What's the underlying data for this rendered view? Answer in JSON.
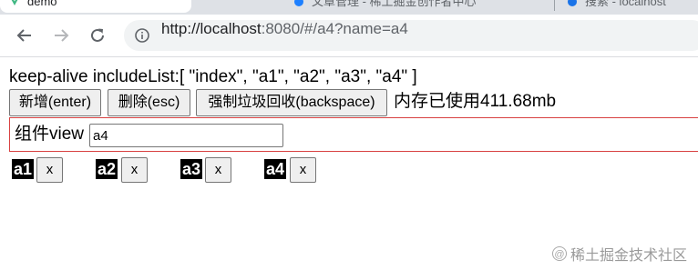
{
  "browser": {
    "tabs": [
      {
        "title": "demo"
      },
      {
        "title": "文章管理 - 稀土掘金创作者中心"
      },
      {
        "title": "搜索 - localhost"
      }
    ],
    "omnibox": {
      "url_host": "http://localhost",
      "url_rest": ":8080/#/a4?name=a4"
    }
  },
  "page": {
    "include_list_text": "keep-alive includeList:[ \"index\", \"a1\", \"a2\", \"a3\", \"a4\" ]",
    "buttons": {
      "add": "新增(enter)",
      "delete": "删除(esc)",
      "gc": "强制垃圾回收(backspace)"
    },
    "memory_text": "内存已使用411.68mb",
    "view": {
      "label": "组件view",
      "input_value": "a4"
    },
    "chips": [
      {
        "name": "a1",
        "close": "x"
      },
      {
        "name": "a2",
        "close": "x"
      },
      {
        "name": "a3",
        "close": "x"
      },
      {
        "name": "a4",
        "close": "x"
      }
    ]
  },
  "watermark": {
    "icon": "@",
    "text": "稀土掘金技术社区"
  }
}
